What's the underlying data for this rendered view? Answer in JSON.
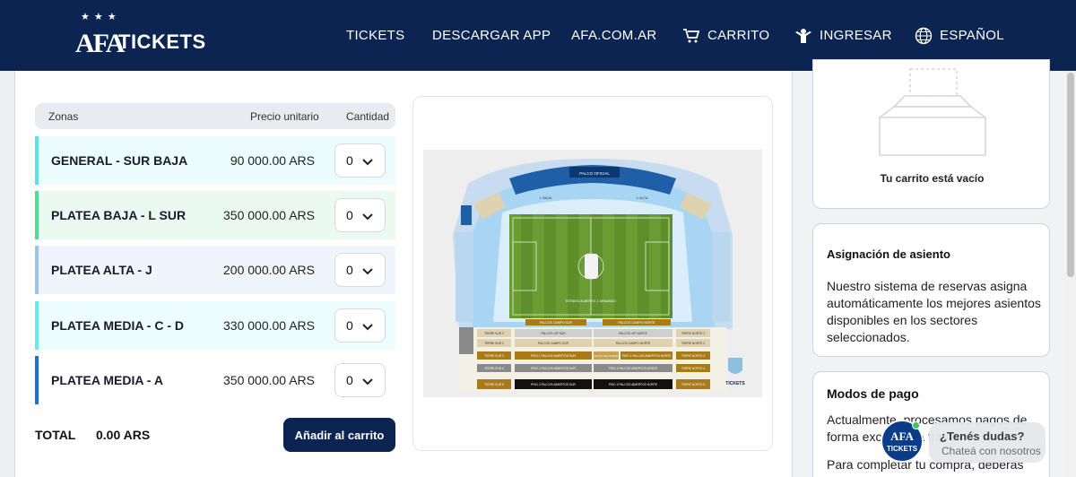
{
  "header": {
    "logo_stars": "★ ★ ★",
    "logo_afa": "AFA",
    "logo_text": "TICKETS",
    "nav": {
      "tickets": "TICKETS",
      "download_app": "DESCARGAR APP",
      "afa_site": "AFA.COM.AR",
      "cart": "CARRITO",
      "login": "INGRESAR",
      "language": "ESPAÑOL"
    }
  },
  "table": {
    "col_zones": "Zonas",
    "col_price": "Precio unitario",
    "col_qty": "Cantidad",
    "rows": [
      {
        "zone": "GENERAL - SUR BAJA",
        "price": "90 000.00 ARS",
        "qty": "0",
        "color": "#5ee0e6",
        "bg": "#ecfbfb"
      },
      {
        "zone": "PLATEA BAJA - L SUR",
        "price": "350 000.00 ARS",
        "qty": "0",
        "color": "#56d98c",
        "bg": "#eafaf0"
      },
      {
        "zone": "PLATEA ALTA - J",
        "price": "200 000.00 ARS",
        "qty": "0",
        "color": "#9ec5e6",
        "bg": "#f0f5fb"
      },
      {
        "zone": "PLATEA MEDIA - C - D",
        "price": "330 000.00 ARS",
        "qty": "0",
        "color": "#6de8e8",
        "bg": "#edfcfc"
      },
      {
        "zone": "PLATEA MEDIA - A",
        "price": "350 000.00 ARS",
        "qty": "0",
        "color": "#1f6fd0",
        "bg": "#ffffff"
      }
    ],
    "total_label": "TOTAL",
    "total_value": "0.00 ARS",
    "add_button": "Añadir al carrito"
  },
  "stadium_map": {
    "top_box": "PALCO OFICIAL",
    "field_label": "ESTADIO ALBERTO J. ARMANDO",
    "sides": [
      "L BAJA",
      "L ALTA",
      "H BAJA",
      "SUR BAJA",
      "NORTE BAJA"
    ],
    "box_rows": [
      [
        "PALCOS CAMPO SUR",
        "PALCOS CAMPO NORTE"
      ],
      [
        "TERRE SUR 1",
        "PALCOS VIP SUR",
        "PALCOS VIP NORTE",
        "TERRE NORTE 1"
      ],
      [
        "TERRE SUR 2",
        "PALCOS CAMPO SUR",
        "PALCOS CAMPO NORTE",
        "TERRE NORTE 2"
      ],
      [
        "TERRE SUR 3",
        "PISO 1 PALCOS ABIERTOS SUR",
        "PALCO DE HONOR",
        "PISO 1 PALCOS ABIERTOS NORTE",
        "TERRE NORTE 3"
      ],
      [
        "TERRE SUR 4",
        "PISO 2 PALCOS ABIERTOS SUR",
        "PISO 2 PALCOS ABIERTOS NORTE",
        "TERRE NORTE 4"
      ],
      [
        "TERRE SUR 5",
        "PISO 3 PALCOS ABIERTOS SUR",
        "PISO 3 PALCOS ABIERTOS NORTE",
        "TERRE NORTE 5"
      ]
    ],
    "brand": "TICKETS"
  },
  "cart": {
    "empty_text": "Tu carrito está vacío"
  },
  "seat_assignment": {
    "title": "Asignación de asiento",
    "body": "Nuestro sistema de reservas asigna automáticamente los mejores asientos disponibles en los sectores seleccionados."
  },
  "payment": {
    "title": "Modos de pago",
    "body1": "Actualmente, procesamos pagos de forma exclusiva a través",
    "body2": "Para completar tu compra, deberás utilizar una tarjeta MODO"
  },
  "chat": {
    "badge_afa": "AFA",
    "badge_text": "TICKETS",
    "title": "¿Tenés dudas?",
    "subtitle": "Chateá con nosotros"
  }
}
